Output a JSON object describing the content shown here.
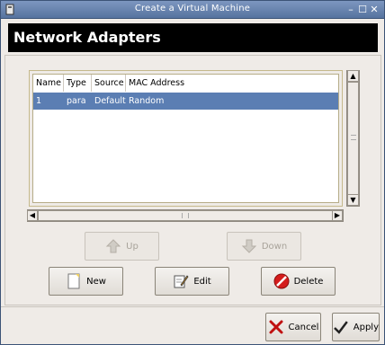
{
  "window": {
    "title": "Create a Virtual Machine"
  },
  "header": {
    "title": "Network Adapters"
  },
  "table": {
    "columns": [
      "Name",
      "Type",
      "Source",
      "MAC Address"
    ],
    "rows": [
      [
        "1",
        "para",
        "Default",
        "Random"
      ]
    ]
  },
  "buttons": {
    "up": "Up",
    "down": "Down",
    "new": "New",
    "edit": "Edit",
    "delete": "Delete",
    "cancel": "Cancel",
    "apply": "Apply"
  },
  "titlebar_controls": {
    "minimize": "–",
    "maximize": "☐",
    "close": "✕"
  },
  "colors": {
    "titlebar": "#56739f",
    "selection": "#5b7eb3",
    "header_bg": "#000000"
  }
}
